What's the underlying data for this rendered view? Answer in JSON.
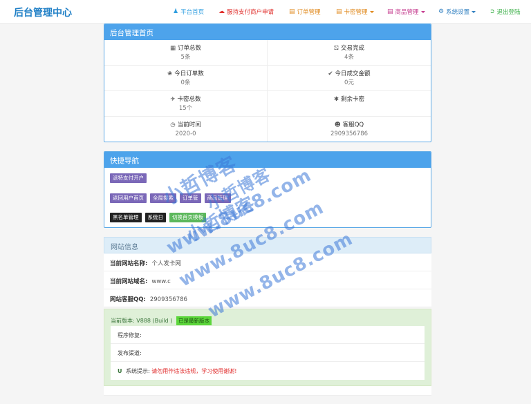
{
  "brand": "后台管理中心",
  "nav": {
    "home": "平台首页",
    "apply": "服持支付商户申请",
    "orders": "订单管理",
    "cards": "卡密管理",
    "goods": "商品管理",
    "settings": "系统设置",
    "logout": "退出登陆"
  },
  "dashboard": {
    "title": "后台管理首页",
    "stats": [
      {
        "icon": "grid-icon",
        "label": "订单总数",
        "value": "5条"
      },
      {
        "icon": "cart-icon",
        "label": "交易完成",
        "value": "4条"
      },
      {
        "icon": "leaf-icon",
        "label": "今日订单数",
        "value": "0条"
      },
      {
        "icon": "check-icon",
        "label": "今日成交金额",
        "value": "0元"
      },
      {
        "icon": "plane-icon",
        "label": "卡密总数",
        "value": "15个"
      },
      {
        "icon": "asterisk-icon",
        "label": "剩余卡密",
        "value": ""
      },
      {
        "icon": "clock-icon",
        "label": "当前时间",
        "value": "2020-0"
      },
      {
        "icon": "qq-icon",
        "label": "客服QQ",
        "value": "2909356786"
      }
    ]
  },
  "quicknav": {
    "title": "快捷导航",
    "row1": [
      "派特支付开户"
    ],
    "row2": [
      "返回用户首页",
      "全局搜索",
      "订单管",
      "商品管理"
    ],
    "row3": [
      "黑名单管理",
      "系统日",
      "切换首页模板"
    ]
  },
  "site": {
    "title": "网站信息",
    "rows": [
      {
        "label": "当前网站名称:",
        "value": "个人发卡网"
      },
      {
        "label": "当前网站域名:",
        "value": "www.c"
      },
      {
        "label": "网站客服QQ:",
        "value": "2909356786"
      }
    ]
  },
  "update": {
    "version_label": "当前版本:",
    "version_value": "V888 (Build )",
    "latest_badge": "已是最新版本",
    "repair_label": "程序修复:",
    "channel_label": "发布渠道:",
    "tip_label": "系统提示:",
    "tip_text": "请勿用作违法违规，学习使用谢谢!"
  },
  "watermark": {
    "blog": "小哲博客",
    "site": "www.8uc8.com"
  },
  "colors": {
    "brand": "#1f7fc6",
    "panel_header": "#4da3eb",
    "purple_btn": "#7b68b8",
    "success_bg": "#dff0d8",
    "latest_badge": "#5cd63b",
    "warning_text": "#e02b2b"
  }
}
